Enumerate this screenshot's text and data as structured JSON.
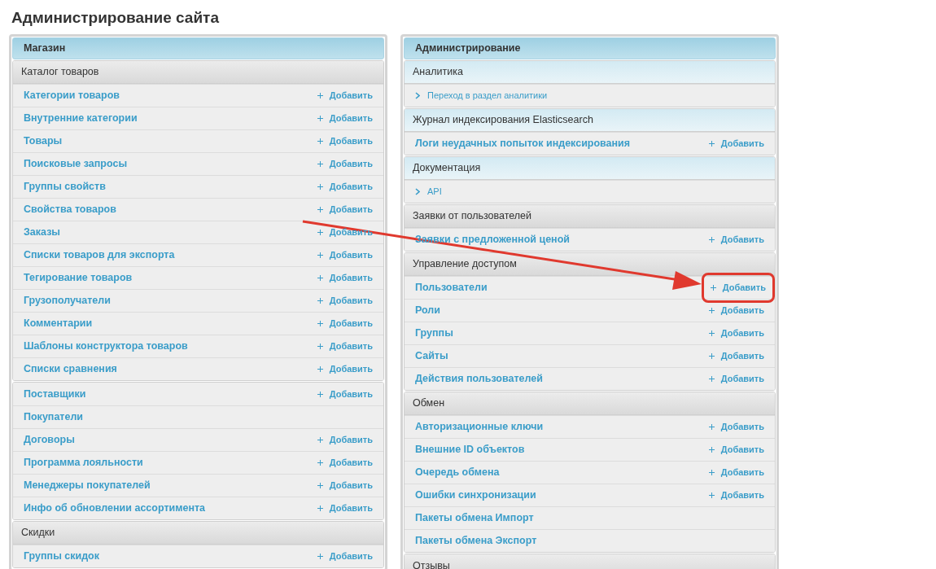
{
  "page_title": "Администрирование сайта",
  "columns": [
    {
      "title": "Магазин",
      "modules": [
        {
          "title": "Каталог товаров",
          "kind": "plain",
          "rows": [
            {
              "label": "Категории товаров",
              "kind": "link",
              "add": "Добавить"
            },
            {
              "label": "Внутренние категории",
              "kind": "link",
              "add": "Добавить"
            },
            {
              "label": "Товары",
              "kind": "link",
              "add": "Добавить"
            },
            {
              "label": "Поисковые запросы",
              "kind": "link",
              "add": "Добавить"
            },
            {
              "label": "Группы свойств",
              "kind": "link",
              "add": "Добавить"
            },
            {
              "label": "Свойства товаров",
              "kind": "link",
              "add": "Добавить"
            },
            {
              "label": "Заказы",
              "kind": "link",
              "add": "Добавить"
            },
            {
              "label": "Списки товаров для экспорта",
              "kind": "link",
              "add": "Добавить"
            },
            {
              "label": "Тегирование товаров",
              "kind": "link",
              "add": "Добавить"
            },
            {
              "label": "Грузополучатели",
              "kind": "link",
              "add": "Добавить"
            },
            {
              "label": "Комментарии",
              "kind": "link",
              "add": "Добавить"
            },
            {
              "label": "Шаблоны конструктора товаров",
              "kind": "link",
              "add": "Добавить"
            },
            {
              "label": "Списки сравнения",
              "kind": "link",
              "add": "Добавить"
            }
          ]
        },
        {
          "rows": [
            {
              "label": "Поставщики",
              "kind": "link",
              "add": "Добавить"
            },
            {
              "label": "Покупатели",
              "kind": "link"
            },
            {
              "label": "Договоры",
              "kind": "link",
              "add": "Добавить"
            },
            {
              "label": "Программа лояльности",
              "kind": "link",
              "add": "Добавить"
            },
            {
              "label": "Менеджеры покупателей",
              "kind": "link",
              "add": "Добавить"
            },
            {
              "label": "Инфо об обновлении ассортимента",
              "kind": "link",
              "add": "Добавить"
            }
          ]
        },
        {
          "title": "Скидки",
          "kind": "plain",
          "rows": [
            {
              "label": "Группы скидок",
              "kind": "link",
              "add": "Добавить"
            }
          ]
        }
      ]
    },
    {
      "title": "Администрирование",
      "modules": [
        {
          "title": "Аналитика",
          "kind": "tinted",
          "rows": [
            {
              "label": "Переход в раздел аналитики",
              "kind": "nav"
            }
          ]
        },
        {
          "title": "Журнал индексирования Elasticsearch",
          "kind": "tinted",
          "rows": [
            {
              "label": "Логи неудачных попыток индексирования",
              "kind": "link",
              "add": "Добавить"
            }
          ]
        },
        {
          "title": "Документация",
          "kind": "tinted",
          "rows": [
            {
              "label": "API",
              "kind": "nav"
            }
          ]
        },
        {
          "title": "Заявки от пользователей",
          "kind": "plain",
          "rows": [
            {
              "label": "Заявки с предложенной ценой",
              "kind": "link",
              "add": "Добавить"
            }
          ]
        },
        {
          "title": "Управление доступом",
          "kind": "plain",
          "rows": [
            {
              "label": "Пользователи",
              "kind": "link",
              "add": "Добавить",
              "highlighted": true
            },
            {
              "label": "Роли",
              "kind": "link",
              "add": "Добавить"
            },
            {
              "label": "Группы",
              "kind": "link",
              "add": "Добавить"
            },
            {
              "label": "Сайты",
              "kind": "link",
              "add": "Добавить"
            },
            {
              "label": "Действия пользователей",
              "kind": "link",
              "add": "Добавить"
            }
          ]
        },
        {
          "title": "Обмен",
          "kind": "plain",
          "rows": [
            {
              "label": "Авторизационные ключи",
              "kind": "link",
              "add": "Добавить"
            },
            {
              "label": "Внешние ID объектов",
              "kind": "link",
              "add": "Добавить"
            },
            {
              "label": "Очередь обмена",
              "kind": "link",
              "add": "Добавить"
            },
            {
              "label": "Ошибки синхронизации",
              "kind": "link",
              "add": "Добавить"
            },
            {
              "label": "Пакеты обмена Импорт",
              "kind": "link"
            },
            {
              "label": "Пакеты обмена Экспорт",
              "kind": "link"
            }
          ]
        },
        {
          "title": "Отзывы",
          "kind": "plain"
        }
      ]
    }
  ]
}
